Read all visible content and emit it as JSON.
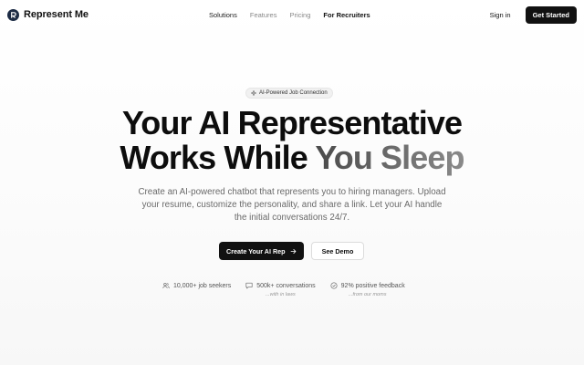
{
  "brand": {
    "name": "Represent Me",
    "logo_icon": "representme-logo-icon"
  },
  "nav": {
    "links": [
      {
        "label": "Solutions"
      },
      {
        "label": "Features"
      },
      {
        "label": "Pricing"
      },
      {
        "label": "For Recruiters"
      }
    ],
    "signin_label": "Sign in",
    "cta_label": "Get Started"
  },
  "hero": {
    "badge_icon": "sparkle-icon",
    "badge_label": "AI-Powered Job Connection",
    "headline_line1": "Your AI Representative",
    "headline_line2_dark": "Works While ",
    "headline_line2_gray": "You Sleep",
    "subheadline": "Create an AI-powered chatbot that represents you to hiring managers. Upload your resume, customize the personality, and share a link. Let your AI handle the initial conversations 24/7.",
    "primary_cta": "Create Your AI Rep",
    "primary_cta_icon": "arrow-right-icon",
    "secondary_cta": "See Demo"
  },
  "stats": [
    {
      "icon": "users-icon",
      "label": "10,000+ job seekers",
      "note": ""
    },
    {
      "icon": "chat-icon",
      "label": "500k+ conversations",
      "note": "...with in laws"
    },
    {
      "icon": "check-circle-icon",
      "label": "92% positive feedback",
      "note": "...from our moms"
    }
  ],
  "colors": {
    "primary_button": "#111111",
    "logo_bg": "#1c2b44",
    "muted_text": "#6a6a6a"
  }
}
